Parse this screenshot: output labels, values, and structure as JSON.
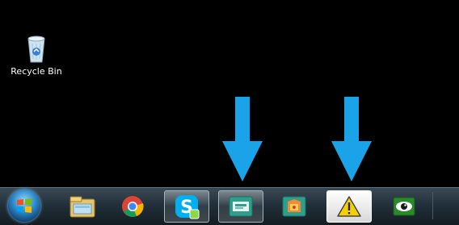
{
  "desktop": {
    "recycle_bin": {
      "label": "Recycle Bin",
      "icon": "recycle-bin-icon"
    }
  },
  "annotations": [
    {
      "icon": "down-arrow-icon",
      "color": "#1aa3e8"
    },
    {
      "icon": "down-arrow-icon",
      "color": "#1aa3e8"
    }
  ],
  "taskbar": {
    "start_button": {
      "icon": "windows-logo-icon"
    },
    "items": [
      {
        "icon": "file-explorer-icon",
        "active": false
      },
      {
        "icon": "chrome-icon",
        "active": false
      },
      {
        "icon": "skype-icon",
        "active": true
      },
      {
        "icon": "app-window-icon",
        "active": true
      },
      {
        "icon": "app-window-colorful-icon",
        "active": false
      },
      {
        "icon": "warning-icon",
        "active": true
      },
      {
        "icon": "eye-icon",
        "active": false
      }
    ]
  },
  "colors": {
    "arrow": "#1aa3e8",
    "skype": "#00aff0",
    "warning": "#f5d000"
  }
}
